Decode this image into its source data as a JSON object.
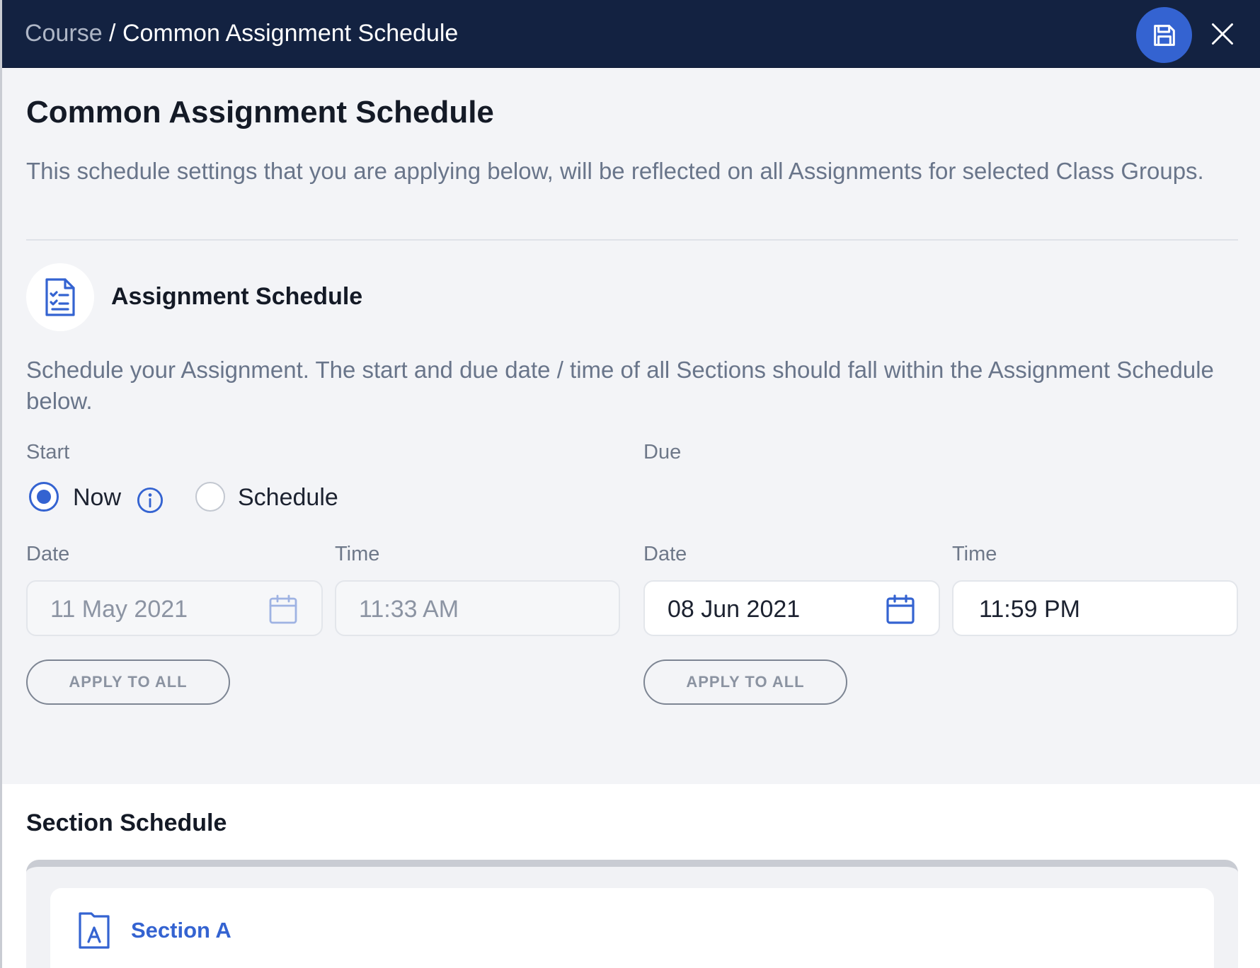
{
  "header": {
    "breadcrumb_parent": "Course",
    "breadcrumb_separator": " / ",
    "breadcrumb_current": "Common Assignment Schedule",
    "save_icon": "save-disk-icon",
    "close_icon": "close-icon"
  },
  "page": {
    "title": "Common Assignment Schedule",
    "description": "This schedule settings that you are applying below, will be reflected on all Assignments for selected Class Groups."
  },
  "assignment_schedule": {
    "title": "Assignment Schedule",
    "icon": "checklist-document-icon",
    "description": "Schedule your Assignment. The start and due date / time of all Sections should fall within the Assignment Schedule below.",
    "start": {
      "label": "Start",
      "options": [
        {
          "label": "Now",
          "selected": true
        },
        {
          "label": "Schedule",
          "selected": false
        }
      ],
      "date_label": "Date",
      "date_value": "11 May 2021",
      "time_label": "Time",
      "time_value": "11:33 AM",
      "apply_label": "APPLY TO ALL"
    },
    "due": {
      "label": "Due",
      "date_label": "Date",
      "date_value": "08 Jun 2021",
      "time_label": "Time",
      "time_value": "11:59 PM",
      "apply_label": "APPLY TO ALL"
    }
  },
  "section_schedule": {
    "title": "Section Schedule",
    "sections": [
      {
        "label": "Section A",
        "icon": "section-a-document-icon"
      }
    ]
  },
  "colors": {
    "header_bg": "#132241",
    "accent": "#3463d1",
    "page_bg": "#f3f4f7"
  }
}
